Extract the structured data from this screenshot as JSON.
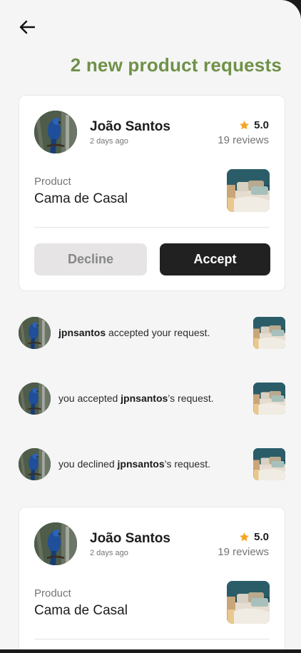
{
  "header": {
    "back_icon": "arrow-left-icon",
    "title": "2 new product requests"
  },
  "colors": {
    "title_green": "#6f9148",
    "star": "#f5a623",
    "accept_bg": "#212121",
    "decline_bg": "#e6e4e5"
  },
  "requests": [
    {
      "user_name": "João Santos",
      "time": "2 days ago",
      "rating": "5.0",
      "reviews": "19 reviews",
      "product_label": "Product",
      "product_name": "Cama de Casal",
      "decline_label": "Decline",
      "accept_label": "Accept"
    },
    {
      "user_name": "João Santos",
      "time": "2 days ago",
      "rating": "5.0",
      "reviews": "19 reviews",
      "product_label": "Product",
      "product_name": "Cama de Casal"
    }
  ],
  "activity": [
    {
      "pre": "",
      "user": "jpnsantos",
      "post": " accepted your request."
    },
    {
      "pre": "you accepted ",
      "user": "jpnsantos",
      "post": "’s request."
    },
    {
      "pre": "you declined ",
      "user": "jpnsantos",
      "post": "’s request."
    }
  ]
}
